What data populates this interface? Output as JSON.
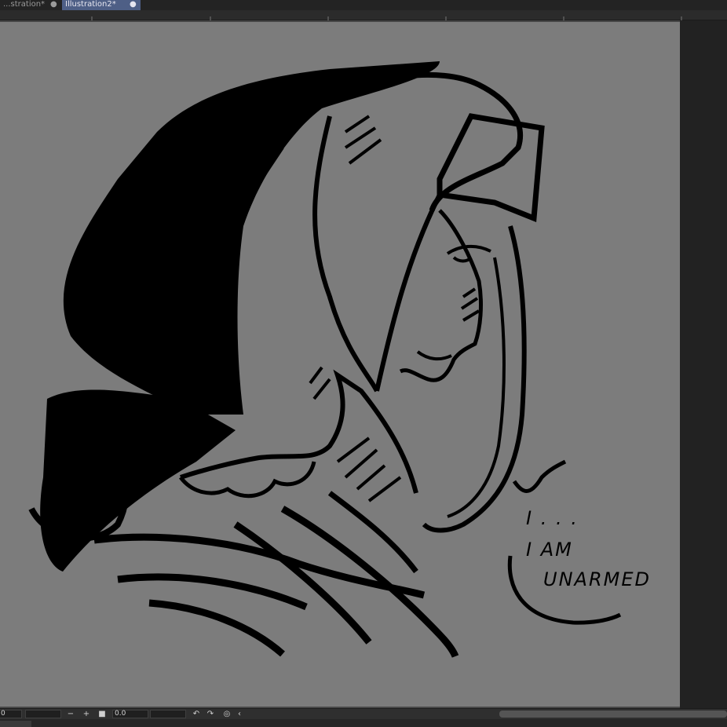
{
  "tabs": [
    {
      "label": "...stration*",
      "modified_marker": "●"
    },
    {
      "label": "Illustration2*",
      "modified_marker": "●"
    }
  ],
  "status_bar": {
    "zoom_value": "0",
    "zoom_out_label": "−",
    "zoom_in_label": "+",
    "rotation_value": "0.0"
  },
  "artwork": {
    "speech_lines": [
      "I . . .",
      "I  AM",
      "UNARMED"
    ]
  },
  "colors": {
    "canvas_gray": "#7c7c7c",
    "active_tab": "#4e5f86",
    "ink": "#000000"
  }
}
